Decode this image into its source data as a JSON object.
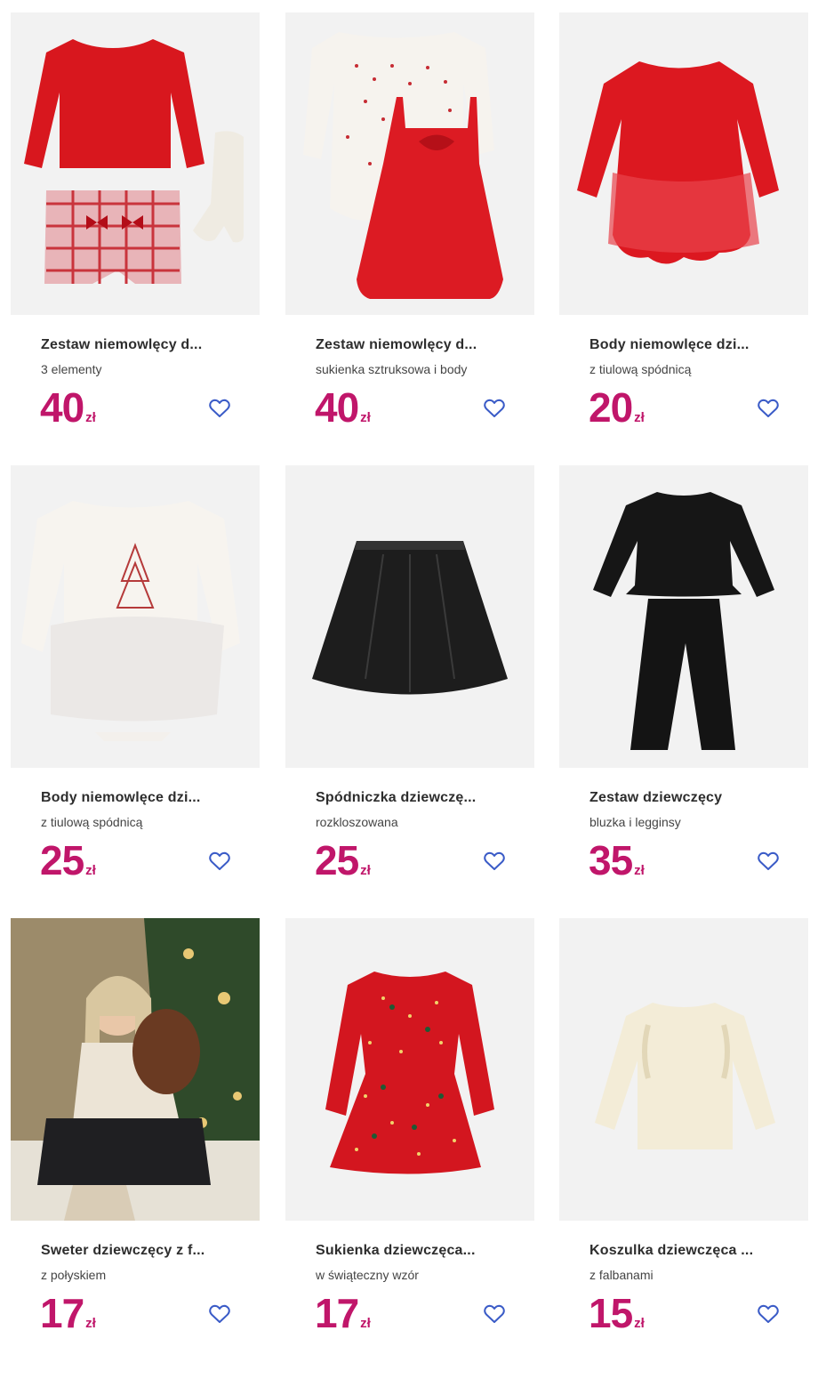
{
  "accent_color": "#c0166a",
  "favorite_icon": "heart-outline-icon",
  "products": [
    {
      "title": "Zestaw niemowlęcy d...",
      "subtitle": "3 elementy",
      "price": "40",
      "currency": "zł"
    },
    {
      "title": "Zestaw niemowlęcy d...",
      "subtitle": "sukienka sztruksowa i body",
      "price": "40",
      "currency": "zł"
    },
    {
      "title": "Body niemowlęce dzi...",
      "subtitle": "z tiulową spódnicą",
      "price": "20",
      "currency": "zł"
    },
    {
      "title": "Body niemowlęce dzi...",
      "subtitle": "z tiulową spódnicą",
      "price": "25",
      "currency": "zł"
    },
    {
      "title": "Spódniczka dziewczę...",
      "subtitle": "rozkloszowana",
      "price": "25",
      "currency": "zł"
    },
    {
      "title": "Zestaw dziewczęcy",
      "subtitle": "bluzka i legginsy",
      "price": "35",
      "currency": "zł"
    },
    {
      "title": "Sweter dziewczęcy z f...",
      "subtitle": "z połyskiem",
      "price": "17",
      "currency": "zł"
    },
    {
      "title": "Sukienka dziewczęca...",
      "subtitle": "w świąteczny wzór",
      "price": "17",
      "currency": "zł"
    },
    {
      "title": "Koszulka dziewczęca ...",
      "subtitle": "z falbanami",
      "price": "15",
      "currency": "zł"
    }
  ]
}
